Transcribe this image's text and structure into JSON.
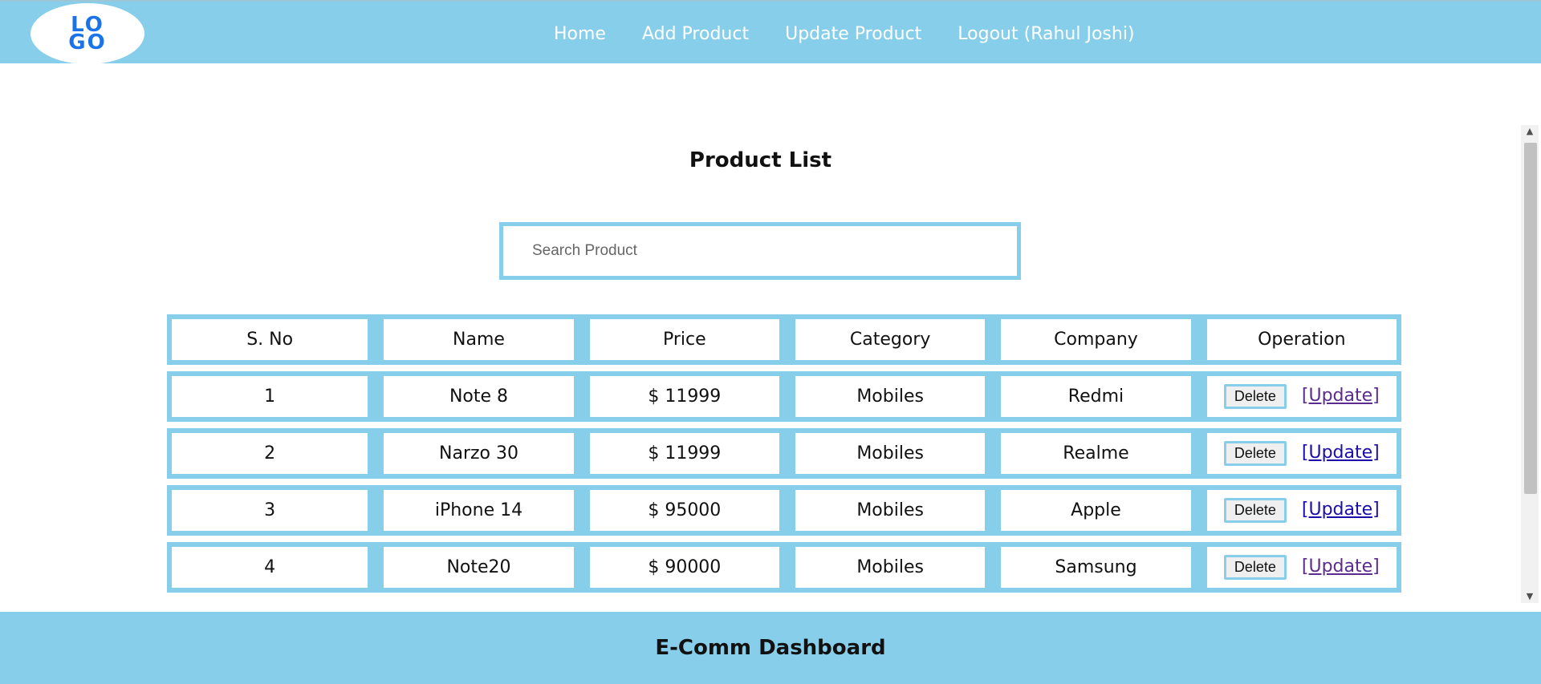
{
  "header": {
    "logo_text": [
      "LO",
      "GO"
    ],
    "nav": [
      "Home",
      "Add Product",
      "Update Product",
      "Logout (Rahul Joshi)"
    ]
  },
  "main": {
    "title": "Product List",
    "search": {
      "placeholder": "Search Product",
      "value": ""
    },
    "table": {
      "headers": [
        "S. No",
        "Name",
        "Price",
        "Category",
        "Company",
        "Operation"
      ],
      "rows": [
        {
          "sno": "1",
          "name": "Note 8",
          "price": "$ 11999",
          "category": "Mobiles",
          "company": "Redmi"
        },
        {
          "sno": "2",
          "name": "Narzo 30",
          "price": "$ 11999",
          "category": "Mobiles",
          "company": "Realme"
        },
        {
          "sno": "3",
          "name": "iPhone 14",
          "price": "$ 95000",
          "category": "Mobiles",
          "company": "Apple"
        },
        {
          "sno": "4",
          "name": "Note20",
          "price": "$ 90000",
          "category": "Mobiles",
          "company": "Samsung"
        }
      ],
      "delete_label": "Delete",
      "update_label": " [Update]"
    }
  },
  "footer": {
    "title": "E-Comm Dashboard"
  },
  "colors": {
    "accent": "#87ceeb",
    "logo": "#1a73e8",
    "link": "#1a0dab",
    "visited_link": "#5b2b8f"
  },
  "icons": {
    "scroll_up": "triangle-up",
    "scroll_down": "triangle-down"
  }
}
